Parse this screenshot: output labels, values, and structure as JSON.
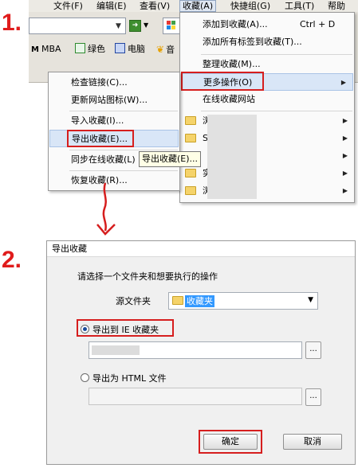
{
  "steps": {
    "one": "1.",
    "two": "2."
  },
  "menubar": {
    "items": [
      "文件(F)",
      "编辑(E)",
      "查看(V)",
      "收藏(A)",
      "快捷组(G)",
      "工具(T)",
      "帮助(H)"
    ]
  },
  "bookmarks_bar": [
    {
      "label": "MBA",
      "icon": "mba-icon"
    },
    {
      "label": "绿色",
      "icon": "green-g-icon"
    },
    {
      "label": "电脑",
      "icon": "computer-icon"
    },
    {
      "label": "音",
      "icon": "music-icon"
    }
  ],
  "favorites_menu": {
    "items": [
      {
        "label": "添加到收藏(A)...",
        "shortcut": "Ctrl + D"
      },
      {
        "label": "添加所有标签到收藏(T)..."
      },
      {
        "label": "整理收藏(M)..."
      },
      {
        "label": "更多操作(O)"
      },
      {
        "label": "在线收藏网站"
      }
    ],
    "folders": [
      "浏",
      "S",
      "",
      "实",
      "浏"
    ]
  },
  "more_menu": {
    "items": [
      {
        "label": "检查链接(C)..."
      },
      {
        "label": "更新网站图标(W)..."
      },
      {
        "label": "导入收藏(I)..."
      },
      {
        "label": "导出收藏(E)..."
      },
      {
        "label": "同步在线收藏(L)"
      },
      {
        "label": "恢复收藏(R)..."
      }
    ]
  },
  "tooltip": {
    "text": "导出收藏(E)..."
  },
  "dialog": {
    "title": "导出收藏",
    "prompt": "请选择一个文件夹和想要执行的操作",
    "source_label": "源文件夹",
    "source_value": "收藏夹",
    "option_ie": "导出到 IE 收藏夹",
    "option_html": "导出为 HTML 文件",
    "browse": "...",
    "ok": "确定",
    "cancel": "取消"
  },
  "colors": {
    "highlight": "#d61e1e",
    "menu_hover": "#d9e6f7",
    "selection": "#3399ff"
  }
}
